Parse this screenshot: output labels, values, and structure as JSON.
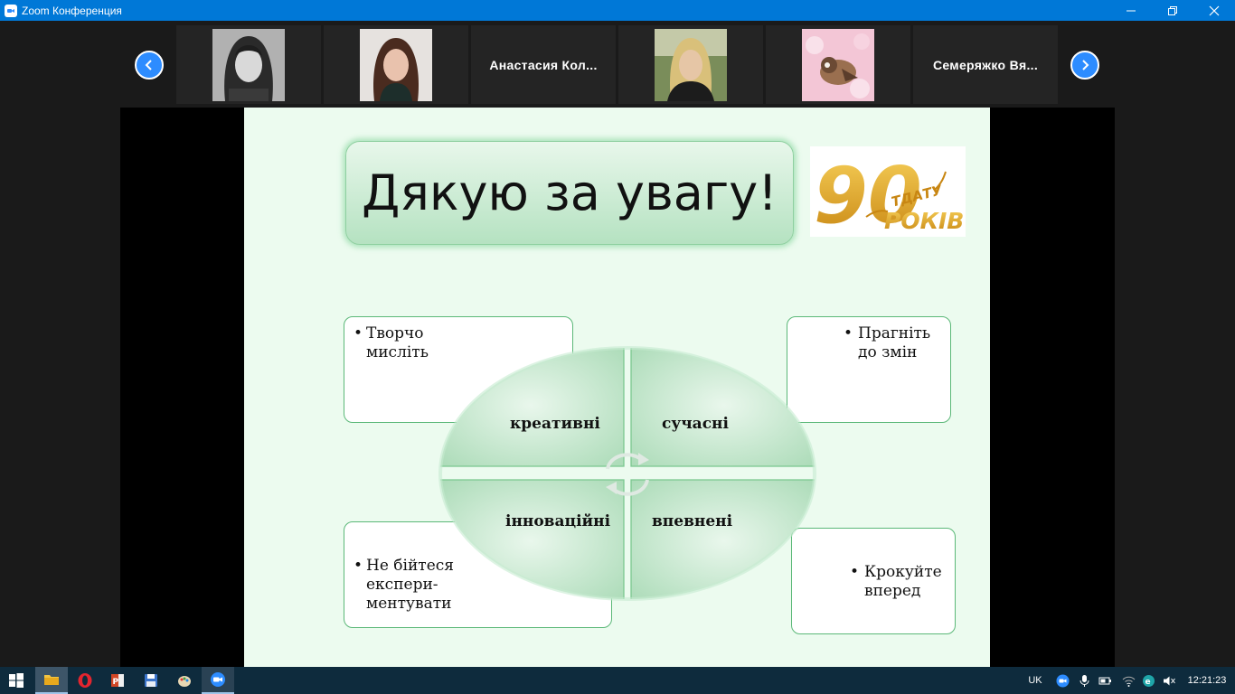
{
  "window": {
    "title": "Zoom Конференция"
  },
  "participants": [
    {
      "type": "photo",
      "icon": "participant-photo-1"
    },
    {
      "type": "photo",
      "icon": "participant-photo-2"
    },
    {
      "type": "name",
      "name": "Анастасия  Кол..."
    },
    {
      "type": "photo",
      "icon": "participant-photo-3"
    },
    {
      "type": "photo",
      "icon": "participant-photo-4"
    },
    {
      "type": "name",
      "name": "Семеряжко  Вя..."
    }
  ],
  "slide": {
    "title": "Дякую за увагу!",
    "logo": {
      "number": "90",
      "arc_text": "ТДАТУ",
      "word": "РОКІВ"
    },
    "cards": {
      "top_left": [
        "Творчо",
        "мисліть"
      ],
      "top_right": [
        "Прагніть",
        "до змін"
      ],
      "bottom_left": [
        "Не бійтеся",
        "експери-",
        "ментувати"
      ],
      "bottom_right": [
        "Крокуйте",
        "вперед"
      ]
    },
    "quadrants": {
      "top_left": "креативні",
      "top_right": "сучасні",
      "bottom_left": "інноваційні",
      "bottom_right": "впевнені"
    },
    "bullet": "•"
  },
  "taskbar": {
    "language": "UK",
    "time": "12:21:23"
  },
  "colors": {
    "titlebar": "#0078d7",
    "zoom_blue": "#2d8cff",
    "slide_bg": "#ecfbef",
    "accent_green": "#5bb878",
    "logo_gold": "#e0a52a",
    "taskbar": "#0e2b3d"
  }
}
